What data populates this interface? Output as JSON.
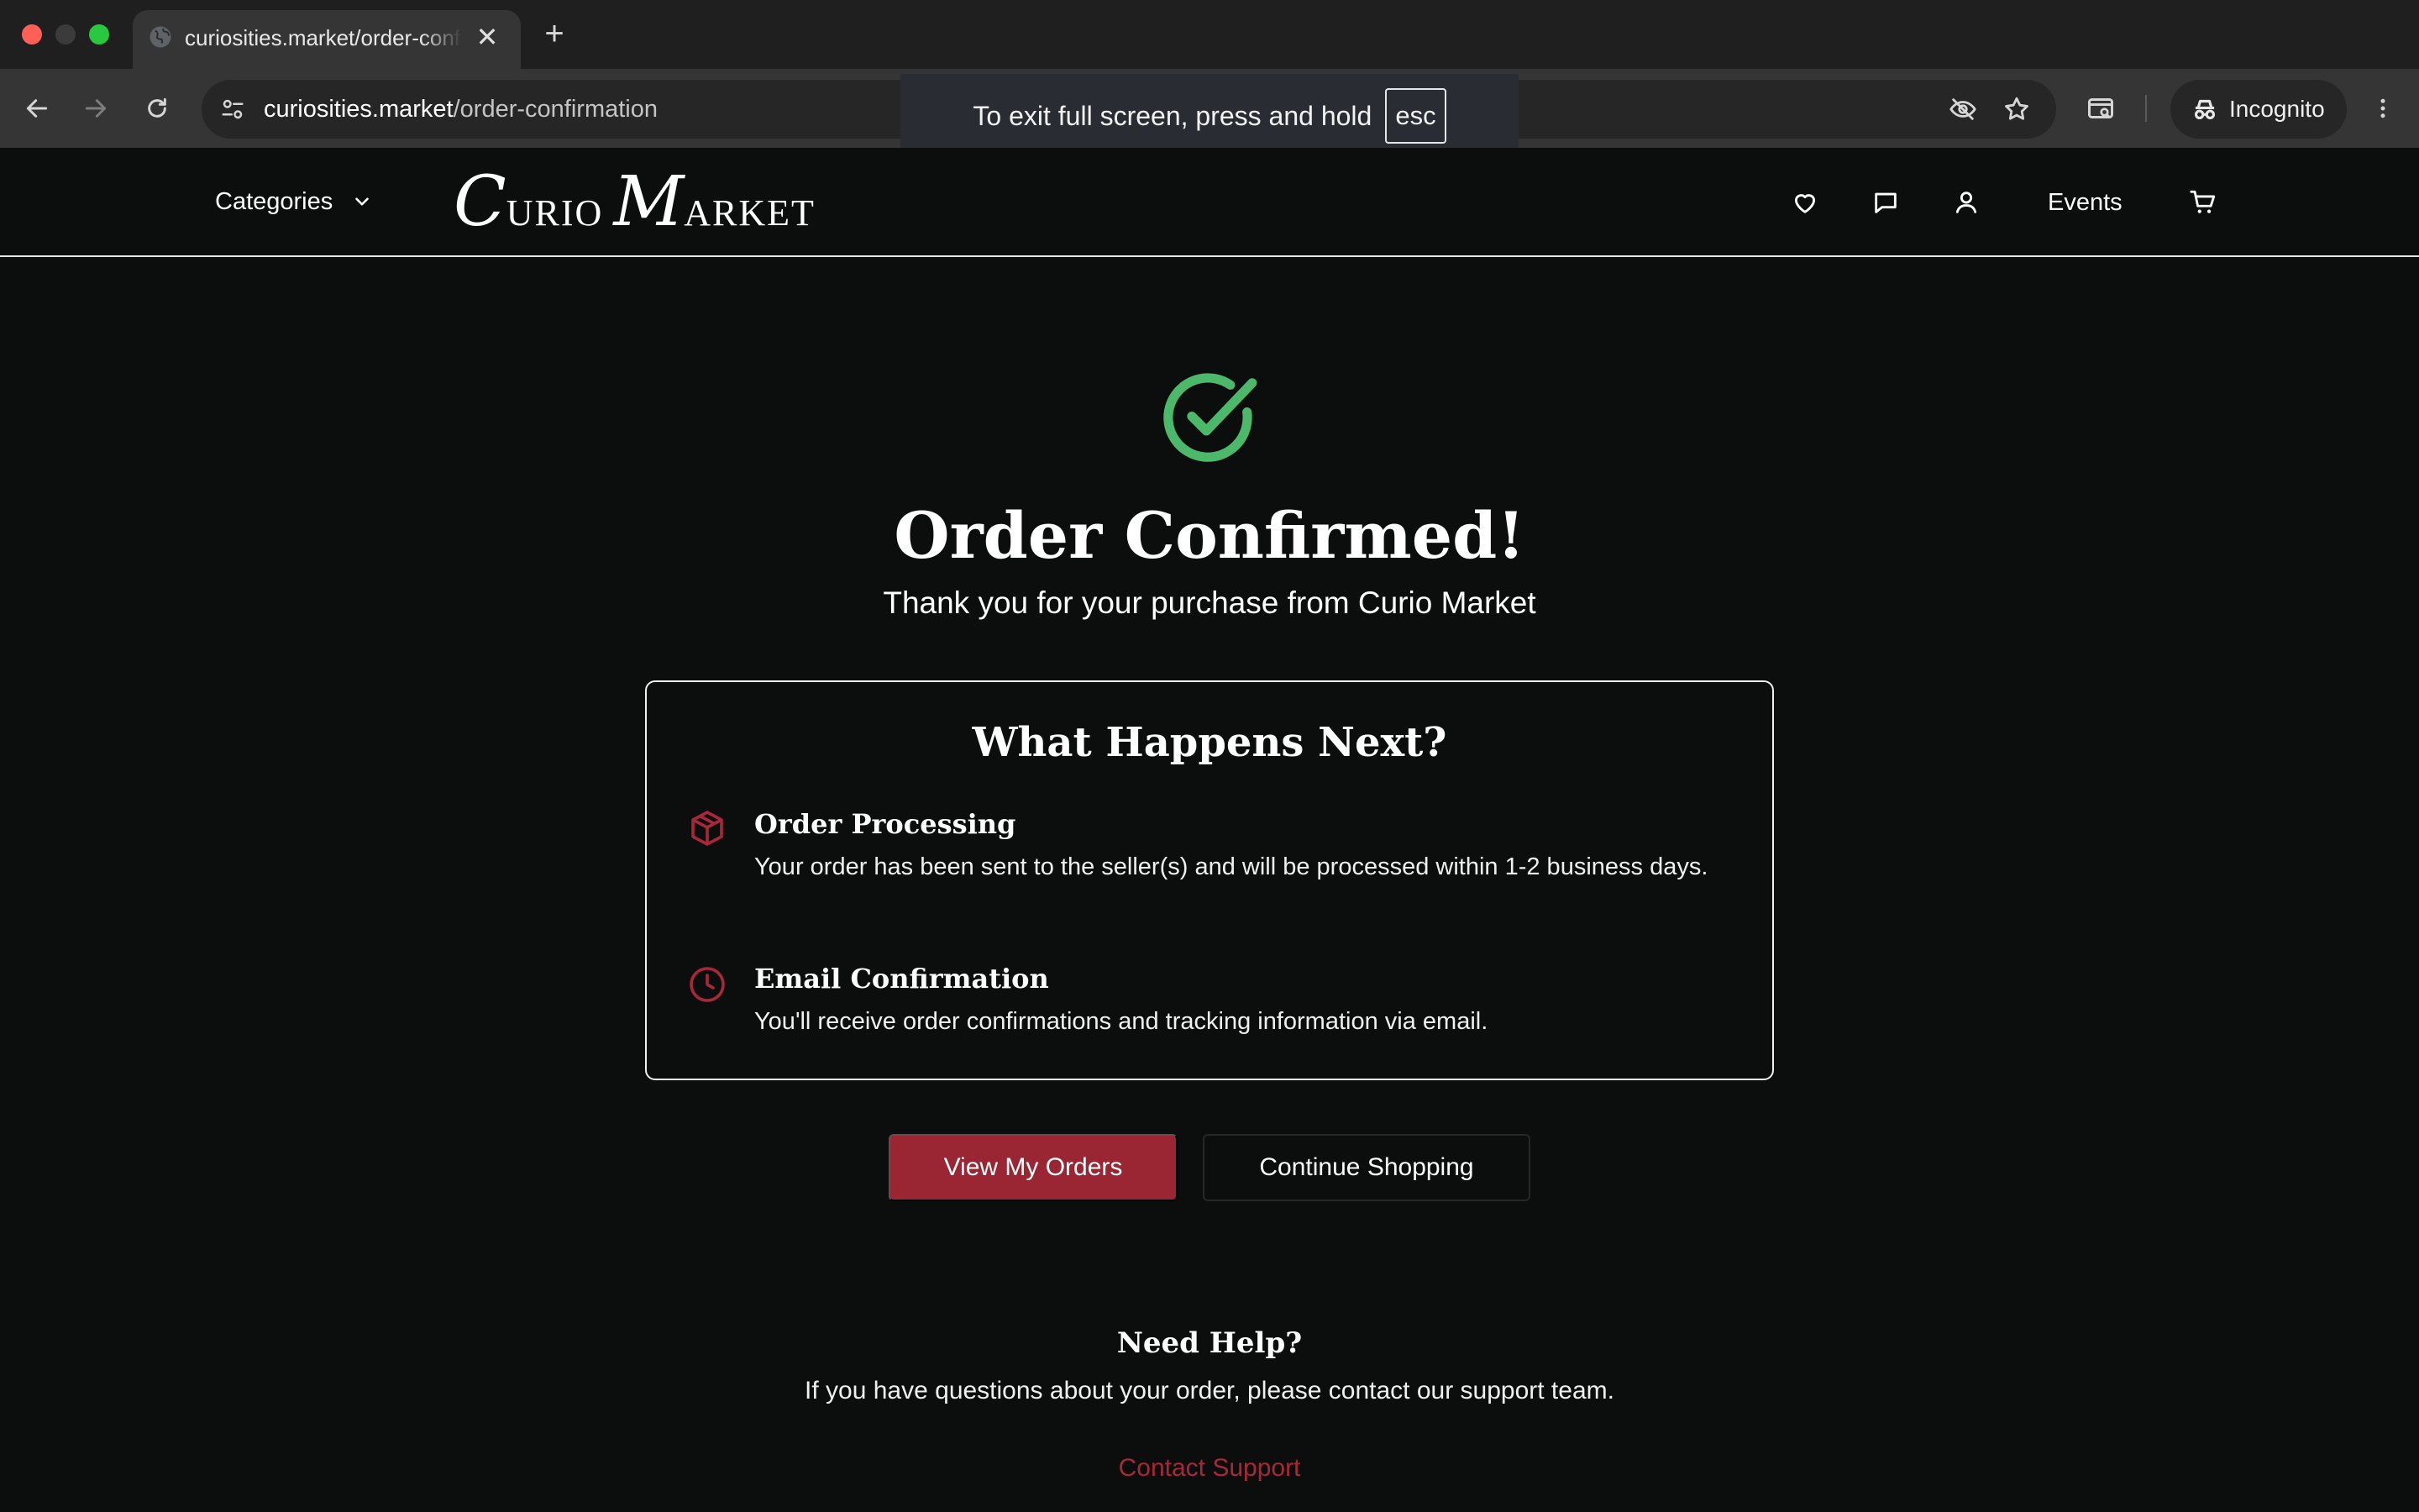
{
  "browser": {
    "tab_title": "curiosities.market/order-confirmation",
    "url_host": "curiosities.market",
    "url_path": "/order-confirmation",
    "new_tab_label": "+",
    "close_tab_label": "✕",
    "incognito_label": "Incognito",
    "fullscreen_toast": {
      "text": "To exit full screen, press and hold",
      "key": "esc"
    }
  },
  "header": {
    "categories_label": "Categories",
    "logo": {
      "first_initial": "C",
      "first_rest": "URIO",
      "second_initial": "M",
      "second_rest": "ARKET"
    },
    "events_label": "Events",
    "icons": [
      "heart-icon",
      "message-icon",
      "user-icon",
      "cart-icon"
    ]
  },
  "confirmation": {
    "title": "Order Confirmed!",
    "subtitle": "Thank you for your purchase from Curio Market"
  },
  "next_steps": {
    "title": "What Happens Next?",
    "items": [
      {
        "icon": "package-icon",
        "title": "Order Processing",
        "description": "Your order has been sent to the seller(s) and will be processed within 1-2 business days."
      },
      {
        "icon": "clock-icon",
        "title": "Email Confirmation",
        "description": "You'll receive order confirmations and tracking information via email."
      }
    ]
  },
  "actions": {
    "primary_label": "View My Orders",
    "secondary_label": "Continue Shopping"
  },
  "help": {
    "title": "Need Help?",
    "text": "If you have questions about your order, please contact our support team.",
    "link_label": "Contact Support"
  },
  "colors": {
    "accent": "#9a2533",
    "success": "#4cb96a",
    "background": "#0c0d0d"
  }
}
